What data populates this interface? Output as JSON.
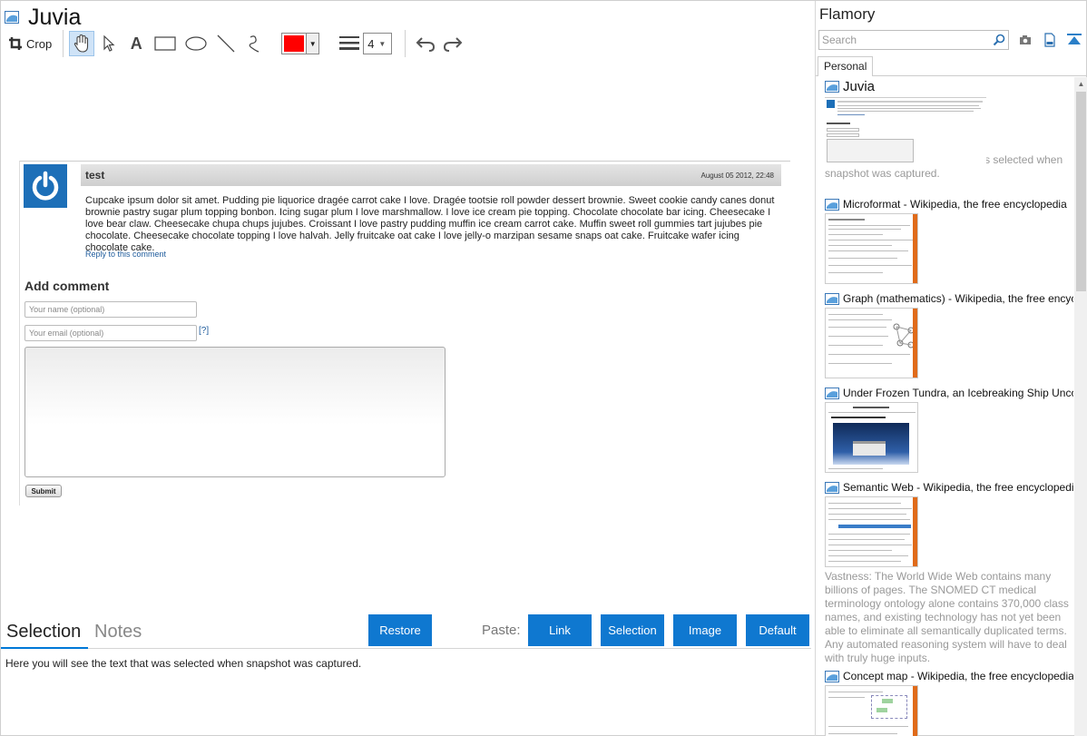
{
  "document": {
    "title": "Juvia"
  },
  "toolbar": {
    "crop_label": "Crop",
    "color": "#ff0000",
    "line_width": "4",
    "tools": [
      "hand-tool",
      "pointer-tool",
      "text-tool",
      "rectangle-tool",
      "ellipse-tool",
      "line-tool",
      "freehand-tool"
    ]
  },
  "snapshot": {
    "comment_author": "test",
    "comment_date": "August 05 2012, 22:48",
    "comment_body": "Cupcake ipsum dolor sit amet. Pudding pie liquorice dragée carrot cake I love. Dragée tootsie roll powder dessert brownie. Sweet cookie candy canes donut brownie pastry sugar plum topping bonbon. Icing sugar plum I love marshmallow. I love ice cream pie topping. Chocolate chocolate bar icing. Cheesecake I love bear claw. Cheesecake chupa chups jujubes. Croissant I love pastry pudding muffin ice cream carrot cake. Muffin sweet roll gummies tart jujubes pie chocolate. Cheesecake chocolate topping I love halvah. Jelly fruitcake oat cake I love jelly-o marzipan sesame snaps oat cake. Fruitcake wafer icing chocolate cake.",
    "reply_link": "Reply to this comment",
    "add_comment_heading": "Add comment",
    "name_placeholder": "Your name (optional)",
    "email_placeholder": "Your email (optional)",
    "help_link": "[?]",
    "submit_label": "Submit"
  },
  "bottom": {
    "tab_selection": "Selection",
    "tab_notes": "Notes",
    "restore_label": "Restore",
    "paste_label": "Paste:",
    "paste_buttons": [
      "Link",
      "Selection",
      "Image",
      "Default"
    ],
    "selection_text": "Here you will see the text that was selected when snapshot was captured."
  },
  "sidebar": {
    "app_title": "Flamory",
    "search_placeholder": "Search",
    "tab_personal": "Personal",
    "items": [
      {
        "title": "Juvia",
        "desc": "Here you will see the text that was selected when snapshot was captured."
      },
      {
        "title": "Microformat - Wikipedia, the free encyclopedia",
        "desc": ""
      },
      {
        "title": "Graph (mathematics) - Wikipedia, the free encyclopedia",
        "desc": ""
      },
      {
        "title": "Under Frozen Tundra, an Icebreaking Ship Uncovers",
        "desc": ""
      },
      {
        "title": "Semantic Web - Wikipedia, the free encyclopedia",
        "desc": "Vastness: The World Wide Web contains many billions of pages. The SNOMED CT medical terminology ontology alone contains 370,000 class names, and existing technology has not yet been able to eliminate all semantically duplicated terms. Any automated reasoning system will have to deal with truly huge inputs."
      },
      {
        "title": "Concept map - Wikipedia, the free encyclopedia",
        "desc": ""
      }
    ]
  },
  "colors": {
    "accent": "#0f78d0",
    "avatar": "#1d6fb8",
    "link": "#1f5c9c"
  }
}
